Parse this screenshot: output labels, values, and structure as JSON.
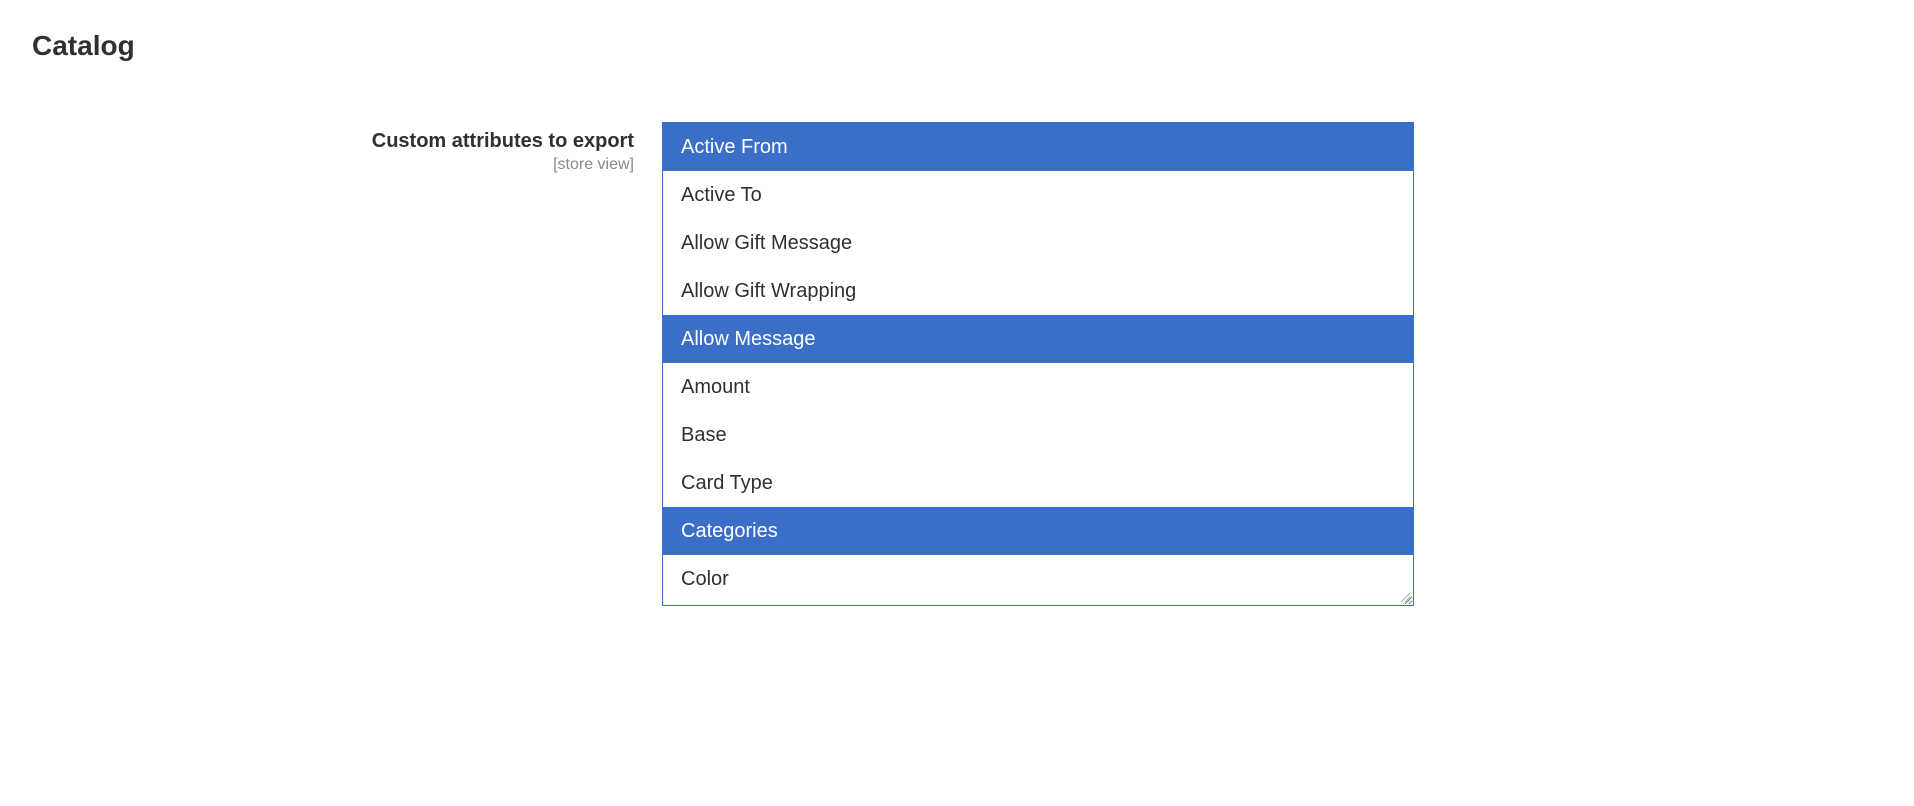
{
  "section_title": "Catalog",
  "field": {
    "label": "Custom attributes to export",
    "scope": "[store view]",
    "options": [
      {
        "label": "Active From",
        "selected": true
      },
      {
        "label": "Active To",
        "selected": false
      },
      {
        "label": "Allow Gift Message",
        "selected": false
      },
      {
        "label": "Allow Gift Wrapping",
        "selected": false
      },
      {
        "label": "Allow Message",
        "selected": true
      },
      {
        "label": "Amount",
        "selected": false
      },
      {
        "label": "Base",
        "selected": false
      },
      {
        "label": "Card Type",
        "selected": false
      },
      {
        "label": "Categories",
        "selected": true
      },
      {
        "label": "Color",
        "selected": false
      }
    ]
  }
}
